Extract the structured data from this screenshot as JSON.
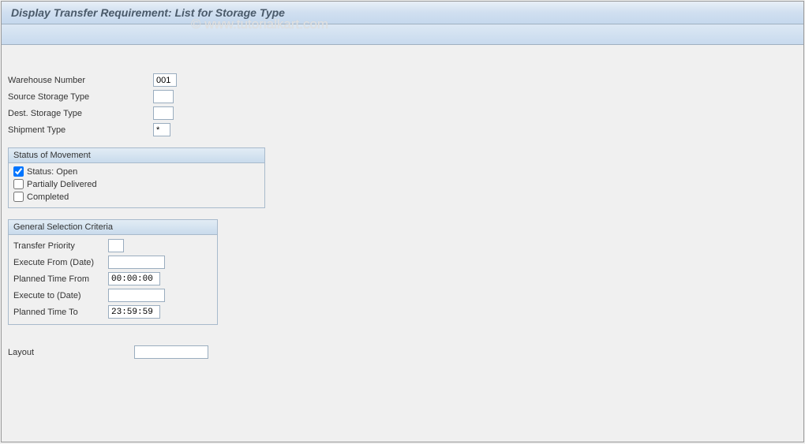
{
  "title": "Display Transfer Requirement: List for Storage Type",
  "watermark": "© www.tutorialkart.com",
  "fields": {
    "warehouse_number": {
      "label": "Warehouse Number",
      "value": "001"
    },
    "source_storage_type": {
      "label": "Source Storage Type",
      "value": ""
    },
    "dest_storage_type": {
      "label": "Dest. Storage Type",
      "value": ""
    },
    "shipment_type": {
      "label": "Shipment Type",
      "value": "*"
    }
  },
  "status_group": {
    "title": "Status of Movement",
    "open": {
      "label": "Status: Open",
      "checked": true
    },
    "partially": {
      "label": "Partially Delivered",
      "checked": false
    },
    "completed": {
      "label": "Completed",
      "checked": false
    }
  },
  "criteria_group": {
    "title": "General Selection Criteria",
    "transfer_priority": {
      "label": "Transfer Priority",
      "value": ""
    },
    "execute_from": {
      "label": "Execute From (Date)",
      "value": ""
    },
    "planned_from": {
      "label": "Planned Time From",
      "value": "00:00:00"
    },
    "execute_to": {
      "label": "Execute to (Date)",
      "value": ""
    },
    "planned_to": {
      "label": "Planned Time To",
      "value": "23:59:59"
    }
  },
  "layout": {
    "label": "Layout",
    "value": ""
  }
}
